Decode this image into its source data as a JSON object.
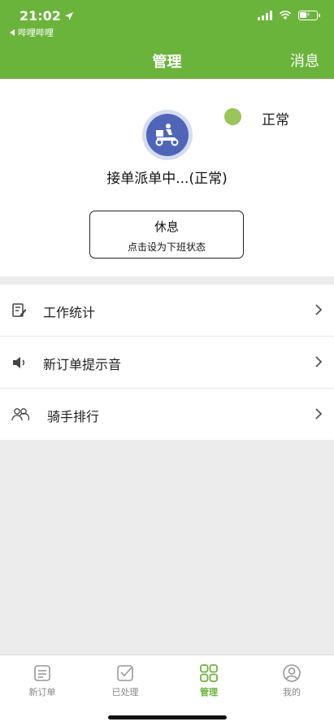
{
  "status_bar": {
    "time": "21:02",
    "back_app": "哔哩哔哩"
  },
  "nav": {
    "title": "管理",
    "right_action": "消息"
  },
  "status": {
    "state_label": "正常",
    "state_color": "#99c65a",
    "dispatch_text": "接单派单中...(正常)",
    "rest_button_title": "休息",
    "rest_button_subtitle": "点击设为下班状态"
  },
  "menu": {
    "items": [
      {
        "label": "工作统计",
        "icon": "edit-note-icon"
      },
      {
        "label": "新订单提示音",
        "icon": "speaker-icon"
      },
      {
        "label": "骑手排行",
        "icon": "users-icon"
      }
    ]
  },
  "tabbar": {
    "tabs": [
      {
        "label": "新订单",
        "icon": "list-icon",
        "active": false
      },
      {
        "label": "已处理",
        "icon": "check-box-icon",
        "active": false
      },
      {
        "label": "管理",
        "icon": "grid-icon",
        "active": true
      },
      {
        "label": "我的",
        "icon": "profile-icon",
        "active": false
      }
    ]
  },
  "colors": {
    "brand": "#6bb43c",
    "avatar_bg": "#4f66b8"
  }
}
